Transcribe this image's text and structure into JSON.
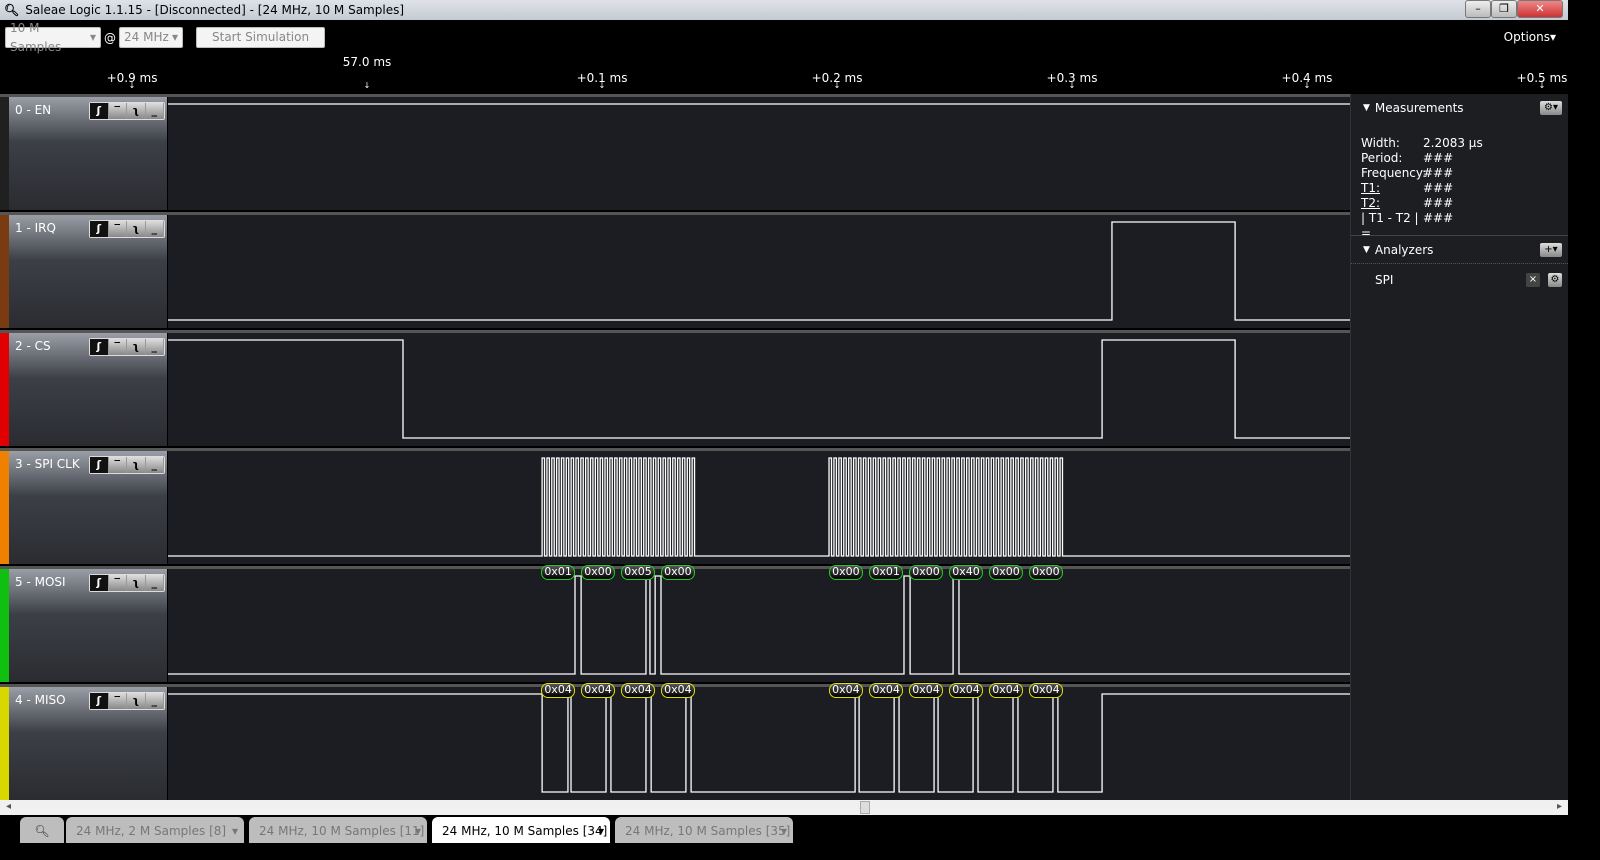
{
  "window": {
    "title": "Saleae Logic 1.1.15 - [Disconnected] - [24 MHz, 10 M Samples]"
  },
  "toolbar": {
    "samples": "10 M Samples",
    "at": "@",
    "rate": "24 MHz",
    "start": "Start Simulation",
    "options": "Options▾"
  },
  "ruler": {
    "cursor_label": "57.0 ms",
    "cursor_us": 0,
    "ticks": [
      {
        "label": "+0.9 ms",
        "us": -100
      },
      {
        "label": "+0.1 ms",
        "us": 100
      },
      {
        "label": "+0.2 ms",
        "us": 200
      },
      {
        "label": "+0.3 ms",
        "us": 300
      },
      {
        "label": "+0.4 ms",
        "us": 400
      },
      {
        "label": "+0.5 ms",
        "us": 500
      }
    ]
  },
  "view_range_us": [
    -84.7,
    418.3
  ],
  "channels": [
    {
      "name": "0 - EN",
      "color": "#202020",
      "init": 1,
      "edges": []
    },
    {
      "name": "1 - IRQ",
      "color": "#7a3a12",
      "init": 0,
      "edges": [
        317.0,
        369.4
      ]
    },
    {
      "name": "2 - CS",
      "color": "#e00000",
      "init": 1,
      "edges": [
        15.3,
        312.8,
        369.4
      ]
    },
    {
      "name": "3 - SPI CLK",
      "color": "#f08000",
      "init": 0,
      "bursts": [
        {
          "start": 74.5,
          "end": 140.4,
          "clocks": 32
        },
        {
          "start": 196.6,
          "end": 297.0,
          "clocks": 48
        }
      ]
    },
    {
      "name": "5 - MOSI",
      "color": "#10c010",
      "init": 0,
      "edges": [
        88.5,
        91.1,
        118.7,
        120.4,
        122.6,
        125.1,
        228.5,
        231.1,
        249.4,
        251.9
      ],
      "decode_color": "#20d020",
      "decoded": [
        {
          "t": 81.3,
          "v": "0x01"
        },
        {
          "t": 98.3,
          "v": "0x00"
        },
        {
          "t": 115.3,
          "v": "0x05"
        },
        {
          "t": 132.3,
          "v": "0x00"
        },
        {
          "t": 203.8,
          "v": "0x00"
        },
        {
          "t": 220.9,
          "v": "0x01"
        },
        {
          "t": 237.9,
          "v": "0x00"
        },
        {
          "t": 254.9,
          "v": "0x40"
        },
        {
          "t": 271.9,
          "v": "0x00"
        },
        {
          "t": 288.9,
          "v": "0x00"
        }
      ]
    },
    {
      "name": "4 - MISO",
      "color": "#d8d800",
      "init": 1,
      "edges": [
        74.5,
        85.5,
        86.8,
        101.7,
        103.8,
        118.7,
        120.9,
        135.7,
        137.9,
        207.7,
        209.4,
        224.3,
        226.4,
        241.3,
        243.0,
        257.9,
        260.0,
        274.9,
        277.0,
        291.9,
        294.0,
        312.8
      ],
      "decode_color": "#e0e000",
      "decoded": [
        {
          "t": 81.3,
          "v": "0x04"
        },
        {
          "t": 98.3,
          "v": "0x04"
        },
        {
          "t": 115.3,
          "v": "0x04"
        },
        {
          "t": 132.3,
          "v": "0x04"
        },
        {
          "t": 203.8,
          "v": "0x04"
        },
        {
          "t": 220.9,
          "v": "0x04"
        },
        {
          "t": 237.9,
          "v": "0x04"
        },
        {
          "t": 254.9,
          "v": "0x04"
        },
        {
          "t": 271.9,
          "v": "0x04"
        },
        {
          "t": 288.9,
          "v": "0x04"
        }
      ]
    }
  ],
  "trigger_icons": [
    "rising-edge",
    "high",
    "falling-edge",
    "low"
  ],
  "measurements": {
    "title": "Measurements",
    "rows": [
      {
        "k": "Width:",
        "v": "2.2083 µs"
      },
      {
        "k": "Period:",
        "v": "###"
      },
      {
        "k": "Frequency:",
        "v": "###"
      },
      {
        "k": "T1:",
        "v": "###"
      },
      {
        "k": "T2:",
        "v": "###"
      },
      {
        "k": "| T1 - T2 | =",
        "v": "###"
      }
    ]
  },
  "analyzers": {
    "title": "Analyzers",
    "items": [
      "SPI"
    ]
  },
  "tabs": [
    {
      "label": "24 MHz, 2 M Samples [8]"
    },
    {
      "label": "24 MHz, 10 M Samples [11]"
    },
    {
      "label": "24 MHz, 10 M Samples [34]",
      "active": true
    },
    {
      "label": "24 MHz, 10 M Samples [35]"
    }
  ]
}
